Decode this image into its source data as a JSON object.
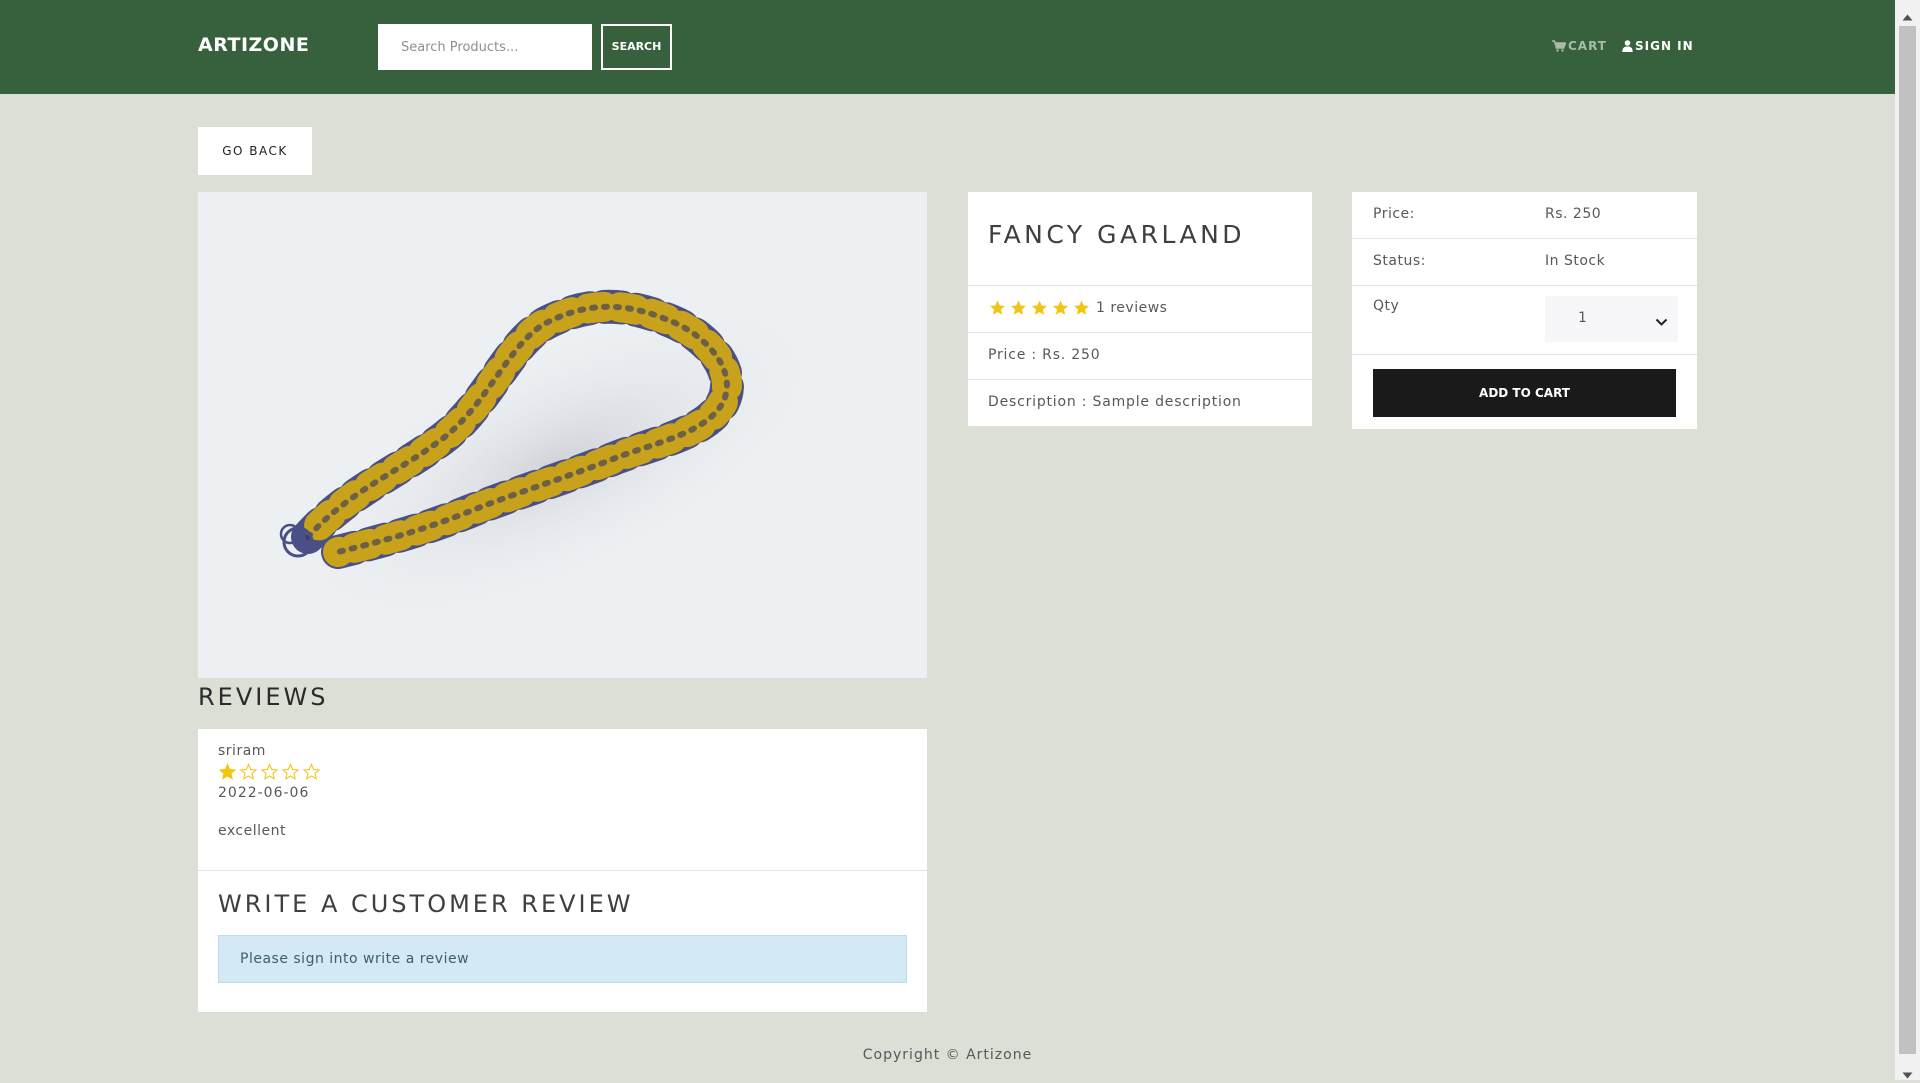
{
  "header": {
    "brand": "ARTIZONE",
    "search_placeholder": "Search Products...",
    "search_button": "SEARCH",
    "cart_label": "CART",
    "signin_label": "SIGN IN",
    "background_color": "#37613d"
  },
  "go_back_label": "GO BACK",
  "product": {
    "name": "FANCY GARLAND",
    "rating_stars": 5,
    "rating_label": "1 reviews",
    "price_text": "Price : Rs. 250",
    "description_text": "Description : Sample description",
    "image_icon": "garland-image"
  },
  "purchase": {
    "price_label": "Price:",
    "price_value": "Rs. 250",
    "status_label": "Status:",
    "status_value": "In Stock",
    "qty_label": "Qty",
    "qty_value": "1",
    "add_to_cart": "ADD TO CART"
  },
  "reviews": {
    "heading": "REVIEWS",
    "items": [
      {
        "user": "sriram",
        "rating": 1,
        "max_rating": 5,
        "date": "2022-06-06",
        "comment": "excellent"
      }
    ],
    "write_heading": "WRITE A CUSTOMER REVIEW",
    "signin_prompt": "Please sign into write a review"
  },
  "footer": {
    "copyright": "Copyright © Artizone"
  },
  "colors": {
    "star": "#f2c511",
    "page_background": "#dcdfd6",
    "button_dark": "#1a1a1a"
  }
}
